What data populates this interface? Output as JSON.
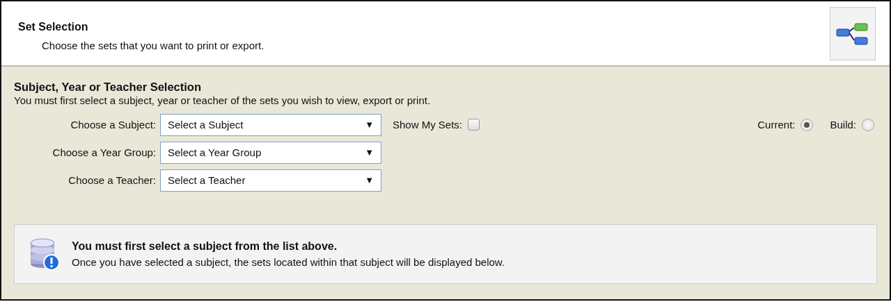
{
  "header": {
    "title": "Set Selection",
    "subtitle": "Choose the sets that you want to print or export."
  },
  "section": {
    "title": "Subject, Year or Teacher Selection",
    "description": "You must first select a subject, year or teacher of the sets you wish to view, export or print."
  },
  "dropdowns": [
    {
      "label": "Choose a Subject:",
      "value": "Select a Subject",
      "arrow": "▼"
    },
    {
      "label": "Choose a Year Group:",
      "value": "Select a Year Group",
      "arrow": "▼"
    },
    {
      "label": "Choose a Teacher:",
      "value": "Select a Teacher",
      "arrow": "▼"
    }
  ],
  "show_my_sets": {
    "label": "Show My Sets:",
    "checked": false
  },
  "mode_options": [
    {
      "label": "Current:",
      "selected": true
    },
    {
      "label": "Build:",
      "selected": false
    }
  ],
  "notice": {
    "title": "You must first select a subject from the list above.",
    "message": "Once you have selected a subject, the sets located within that subject will be displayed below."
  }
}
